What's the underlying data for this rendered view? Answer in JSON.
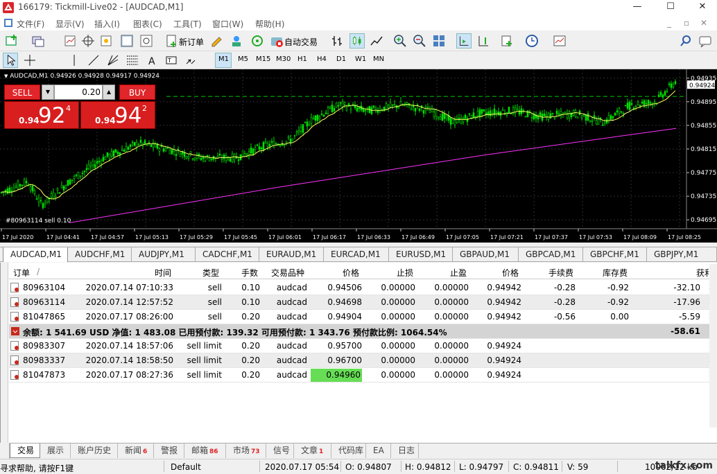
{
  "window": {
    "title": "166179: Tickmill-Live02 - [AUDCAD,M1]",
    "minimize": "—",
    "maximize": "☐",
    "close": "✕"
  },
  "menu": {
    "items": [
      "文件(F)",
      "显示(V)",
      "插入(I)",
      "图表(C)",
      "工具(T)",
      "窗口(W)",
      "帮助(H)"
    ]
  },
  "toolbar": {
    "new_order": "新订单",
    "auto_trading": "自动交易",
    "timeframes": [
      "M1",
      "M5",
      "M15",
      "M30",
      "H1",
      "H4",
      "D1",
      "W1",
      "MN"
    ],
    "active_timeframe": "M1"
  },
  "chart": {
    "symbol_info": "AUDCAD,M1  0.94926 0.94928 0.94917 0.94924",
    "sell_label": "SELL",
    "buy_label": "BUY",
    "lot": "0.20",
    "sell_small": "0.94",
    "sell_big": "92",
    "sell_sup": "4",
    "buy_small": "0.94",
    "buy_big": "94",
    "buy_sup": "2",
    "order_label": "#80963114 sell 0.10",
    "current_price": "0.94924",
    "price_ticks": [
      "0.94935",
      "0.94895",
      "0.94855",
      "0.94815",
      "0.94775",
      "0.94735",
      "0.94695"
    ],
    "time_ticks": [
      "17 Jul 2020",
      "17 Jul 04:41",
      "17 Jul 04:57",
      "17 Jul 05:13",
      "17 Jul 05:29",
      "17 Jul 05:45",
      "17 Jul 06:01",
      "17 Jul 06:17",
      "17 Jul 06:33",
      "17 Jul 06:49",
      "17 Jul 07:05",
      "17 Jul 07:21",
      "17 Jul 07:37",
      "17 Jul 07:53",
      "17 Jul 08:09",
      "17 Jul 08:25"
    ],
    "colors": {
      "candle": "#00e000",
      "ma_fast": "#ffff66",
      "ma_slow": "#ff33ff",
      "grid": "#2e2e2e",
      "dashed_level": "#00cc00"
    }
  },
  "chart_tabs": [
    "AUDCAD,M1",
    "AUDCHF,M1",
    "AUDJPY,M1",
    "CADCHF,M1",
    "EURAUD,M1",
    "EURCAD,M1",
    "EURUSD,M1",
    "GBPAUD,M1",
    "GBPCAD,M1",
    "GBPCHF,M1",
    "GBPJPY,M1"
  ],
  "terminal": {
    "headers": [
      "订单",
      "/",
      "时间",
      "类型",
      "手数",
      "交易品种",
      "价格",
      "止损",
      "止盈",
      "价格",
      "手续费",
      "库存费",
      "获利"
    ],
    "orders": [
      [
        "80963104",
        "2020.07.14 07:10:33",
        "sell",
        "0.10",
        "audcad",
        "0.94506",
        "0.00000",
        "0.00000",
        "0.94942",
        "-0.28",
        "-0.92",
        "-32.10"
      ],
      [
        "80963114",
        "2020.07.14 12:57:52",
        "sell",
        "0.10",
        "audcad",
        "0.94698",
        "0.00000",
        "0.00000",
        "0.94942",
        "-0.28",
        "-0.92",
        "-17.96"
      ],
      [
        "81047865",
        "2020.07.17 08:26:00",
        "sell",
        "0.20",
        "audcad",
        "0.94904",
        "0.00000",
        "0.00000",
        "0.94942",
        "-0.56",
        "0.00",
        "-5.59"
      ]
    ],
    "summary": {
      "text": "余额: 1 541.69 USD  净值: 1 483.08  已用预付款: 139.32  可用预付款: 1 343.76  预付款比例: 1064.54%",
      "profit": "-58.61"
    },
    "pending": [
      [
        "80983307",
        "2020.07.14 18:57:06",
        "sell limit",
        "0.20",
        "audcad",
        "0.95700",
        "0.00000",
        "0.00000",
        "0.94924"
      ],
      [
        "80983337",
        "2020.07.14 18:58:50",
        "sell limit",
        "0.20",
        "audcad",
        "0.96700",
        "0.00000",
        "0.00000",
        "0.94924"
      ],
      [
        "81047873",
        "2020.07.17 08:27:36",
        "sell limit",
        "0.20",
        "audcad",
        "0.94960",
        "0.00000",
        "0.00000",
        "0.94924"
      ]
    ],
    "close_glyph": "✕",
    "highlight_color": "#66dd55"
  },
  "bottom_tabs": [
    {
      "label": "交易",
      "badge": ""
    },
    {
      "label": "展示",
      "badge": ""
    },
    {
      "label": "账户历史",
      "badge": ""
    },
    {
      "label": "新闻",
      "badge": "6"
    },
    {
      "label": "警报",
      "badge": ""
    },
    {
      "label": "邮箱",
      "badge": "86"
    },
    {
      "label": "市场",
      "badge": "73"
    },
    {
      "label": "信号",
      "badge": ""
    },
    {
      "label": "文章",
      "badge": "1"
    },
    {
      "label": "代码库",
      "badge": ""
    },
    {
      "label": "EA",
      "badge": ""
    },
    {
      "label": "日志",
      "badge": ""
    }
  ],
  "statusbar": {
    "help": "寻求帮助, 请按F1键",
    "profile": "Default",
    "datetime": "2020.07.17 05:54",
    "open": "O: 0.94807",
    "high": "H: 0.94812",
    "low": "L: 0.94797",
    "close": "C: 0.94811",
    "volume": "V: 59",
    "traffic": "10062/12 kb"
  },
  "watermark": "talkfx.com"
}
